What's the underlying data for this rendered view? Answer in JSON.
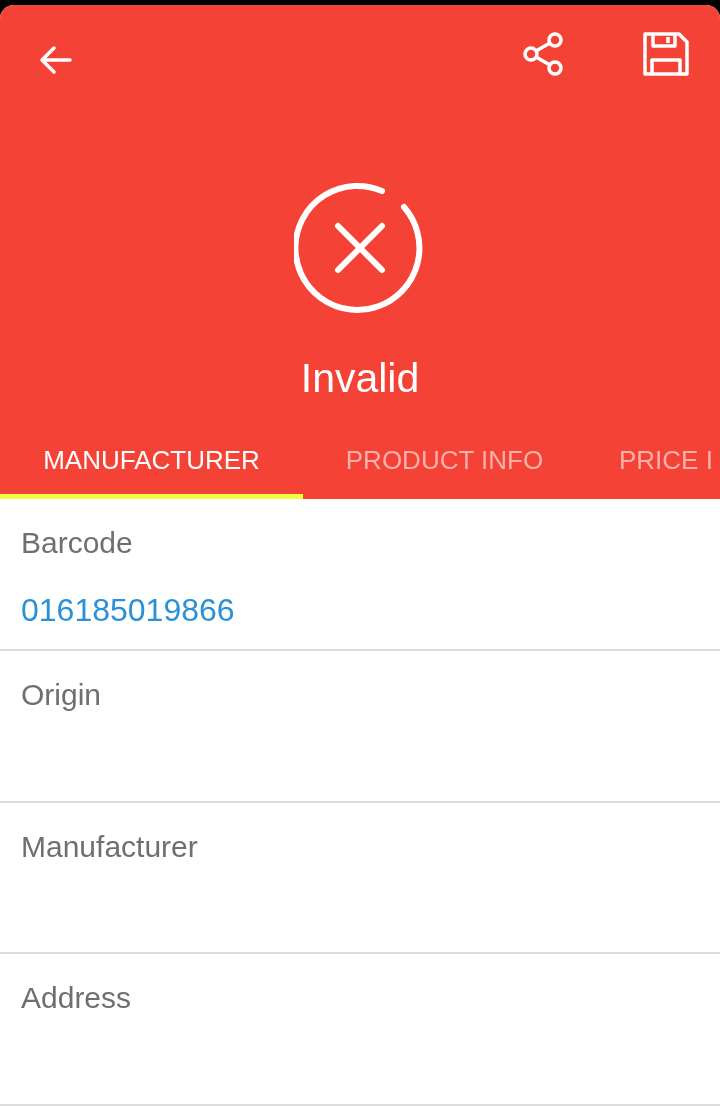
{
  "status": {
    "kind": "invalid",
    "label": "Invalid"
  },
  "tabs": [
    {
      "label": "MANUFACTURER",
      "selected": true
    },
    {
      "label": "PRODUCT INFO",
      "selected": false
    },
    {
      "label": "PRICE I",
      "selected": false
    }
  ],
  "fields": [
    {
      "label": "Barcode",
      "value": "016185019866"
    },
    {
      "label": "Origin"
    },
    {
      "label": "Manufacturer"
    },
    {
      "label": "Address"
    }
  ]
}
